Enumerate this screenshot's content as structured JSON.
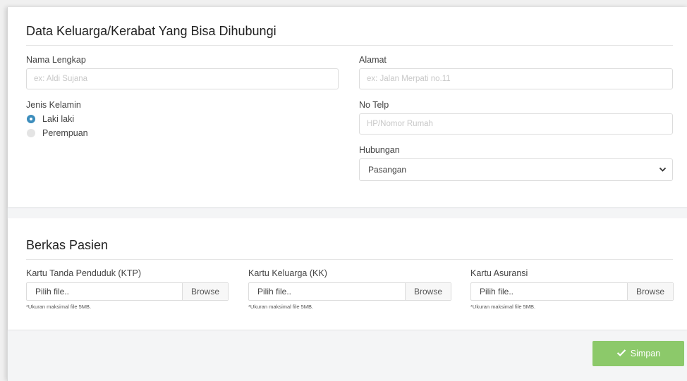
{
  "family_section": {
    "title": "Data Keluarga/Kerabat Yang Bisa Dihubungi",
    "full_name": {
      "label": "Nama Lengkap",
      "placeholder": "ex: Aldi Sujana"
    },
    "address": {
      "label": "Alamat",
      "placeholder": "ex: Jalan Merpati no.11"
    },
    "gender": {
      "label": "Jenis Kelamin",
      "options": [
        "Laki laki",
        "Perempuan"
      ],
      "selected": "Laki laki"
    },
    "phone": {
      "label": "No Telp",
      "placeholder": "HP/Nomor Rumah"
    },
    "relation": {
      "label": "Hubungan",
      "value": "Pasangan"
    }
  },
  "files_section": {
    "title": "Berkas Pasien",
    "uploads": [
      {
        "label": "Kartu Tanda Penduduk (KTP)",
        "placeholder": "Pilih file..",
        "browse": "Browse",
        "hint": "*Ukuran maksimal file 5MB."
      },
      {
        "label": "Kartu Keluarga (KK)",
        "placeholder": "Pilih file..",
        "browse": "Browse",
        "hint": "*Ukuran maksimal file 5MB."
      },
      {
        "label": "Kartu Asuransi",
        "placeholder": "Pilih file..",
        "browse": "Browse",
        "hint": "*Ukuran maksimal file 5MB."
      }
    ]
  },
  "actions": {
    "save_label": "Simpan",
    "save_icon": "check-icon"
  },
  "colors": {
    "primary": "#3c8dbc",
    "save": "#8cc96a"
  }
}
